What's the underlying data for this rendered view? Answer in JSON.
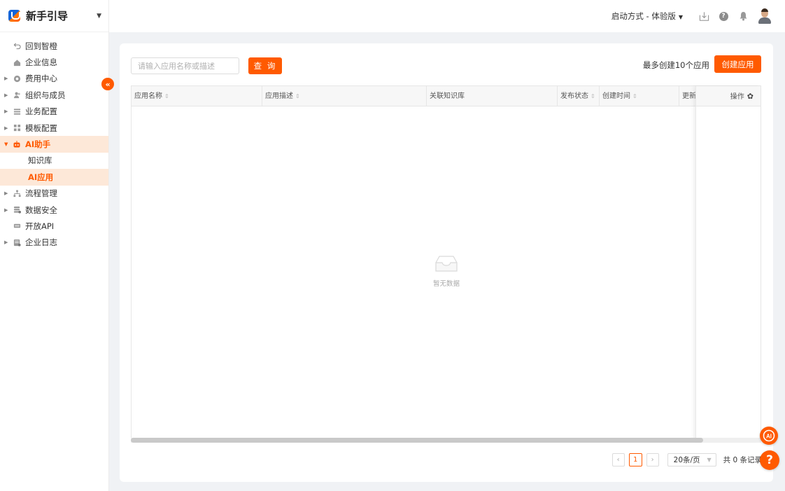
{
  "app": {
    "title": "新手引导"
  },
  "sidebar": {
    "items": [
      {
        "label": "回到智橙",
        "icon": "return-icon"
      },
      {
        "label": "企业信息",
        "icon": "home-icon"
      },
      {
        "label": "费用中心",
        "icon": "billing-icon",
        "expandable": true
      },
      {
        "label": "组织与成员",
        "icon": "users-icon",
        "expandable": true
      },
      {
        "label": "业务配置",
        "icon": "config-icon",
        "expandable": true
      },
      {
        "label": "模板配置",
        "icon": "template-icon",
        "expandable": true
      },
      {
        "label": "AI助手",
        "icon": "robot-icon",
        "expandable": true,
        "expanded": true
      },
      {
        "label": "知识库",
        "sub": true
      },
      {
        "label": "AI应用",
        "sub": true,
        "active": true
      },
      {
        "label": "流程管理",
        "icon": "flow-icon",
        "expandable": true
      },
      {
        "label": "数据安全",
        "icon": "database-icon",
        "expandable": true
      },
      {
        "label": "开放API",
        "icon": "api-icon"
      },
      {
        "label": "企业日志",
        "icon": "log-icon",
        "expandable": true
      }
    ]
  },
  "header": {
    "mode_label": "启动方式 - 体验版"
  },
  "toolbar": {
    "search_placeholder": "请输入应用名称或描述",
    "query_label": "查 询",
    "limit_text": "最多创建10个应用",
    "create_label": "创建应用"
  },
  "table": {
    "columns": [
      "应用名称",
      "应用描述",
      "关联知识库",
      "发布状态",
      "创建时间",
      "更新"
    ],
    "action_column": "操作",
    "rows": [],
    "empty_text": "暂无数据"
  },
  "pagination": {
    "current_page": "1",
    "page_size": "20条/页",
    "total_text": "共 0 条记录"
  },
  "colors": {
    "accent": "#ff5a00",
    "active_bg": "#fde8d8"
  }
}
